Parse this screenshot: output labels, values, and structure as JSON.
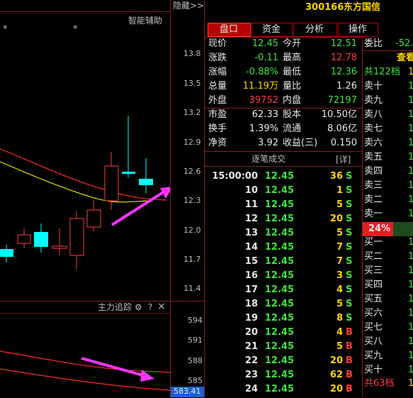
{
  "header": {
    "hide_label": "隐藏>>",
    "code": "300166",
    "name": "东方国信"
  },
  "chart": {
    "assist_label": "智能辅助",
    "stars": [
      "*",
      "*"
    ],
    "price_axis": [
      "13.8",
      "13.5",
      "13.2",
      "12.9",
      "12.6",
      "12.3",
      "12.0",
      "11.7",
      "11.4"
    ],
    "candle_colors": {
      "up": "#ff3b3b",
      "down": "#00ffff",
      "ma1": "#ff2a2a",
      "ma2": "#e8e000"
    },
    "arrow_color": "#ff33ff"
  },
  "tracker": {
    "title": "主力追踪",
    "gear_icon": "gear-icon",
    "help_icon": "?",
    "close_icon": "×",
    "axis": [
      "594",
      "591",
      "588",
      "585"
    ],
    "current_value": "583.41"
  },
  "tabs": [
    {
      "label": "盘口",
      "active": true
    },
    {
      "label": "资金",
      "active": false
    },
    {
      "label": "分析",
      "active": false
    },
    {
      "label": "操作",
      "active": false
    }
  ],
  "quote": {
    "rows": [
      {
        "l1": "现价",
        "v1": "12.45",
        "c1": "grn",
        "l2": "今开",
        "v2": "12.51",
        "c2": "grn"
      },
      {
        "l1": "涨跌",
        "v1": "-0.11",
        "c1": "grn",
        "l2": "最高",
        "v2": "12.78",
        "c2": "red"
      },
      {
        "l1": "涨幅",
        "v1": "-0.88%",
        "c1": "grn",
        "l2": "最低",
        "v2": "12.36",
        "c2": "grn"
      },
      {
        "l1": "总量",
        "v1": "11.19万",
        "c1": "yel",
        "l2": "量比",
        "v2": "1.26",
        "c2": "wht"
      },
      {
        "l1": "外盘",
        "v1": "39752",
        "c1": "red",
        "l2": "内盘",
        "v2": "72197",
        "c2": "grn"
      },
      {
        "l1": "市盈",
        "v1": "62.33",
        "c1": "wht",
        "l2": "股本",
        "v2": "10.50亿",
        "c2": "wht"
      },
      {
        "l1": "换手",
        "v1": "1.39%",
        "c1": "wht",
        "l2": "流通",
        "v2": "8.06亿",
        "c2": "wht"
      },
      {
        "l1": "净资",
        "v1": "3.92",
        "c1": "wht",
        "l2": "收益(三)",
        "v2": "0.150",
        "c2": "wht"
      }
    ]
  },
  "ticks": {
    "title": "逐笔成交",
    "detail_button": "[详]",
    "rows": [
      {
        "time": "15:00:00",
        "price": "12.45",
        "vol": "36",
        "side": "S"
      },
      {
        "time": "10",
        "price": "12.45",
        "vol": "1",
        "side": "S"
      },
      {
        "time": "11",
        "price": "12.45",
        "vol": "5",
        "side": "S"
      },
      {
        "time": "12",
        "price": "12.45",
        "vol": "20",
        "side": "S"
      },
      {
        "time": "13",
        "price": "12.45",
        "vol": "5",
        "side": "S"
      },
      {
        "time": "14",
        "price": "12.45",
        "vol": "7",
        "side": "S"
      },
      {
        "time": "15",
        "price": "12.45",
        "vol": "7",
        "side": "S"
      },
      {
        "time": "16",
        "price": "12.45",
        "vol": "3",
        "side": "S"
      },
      {
        "time": "17",
        "price": "12.45",
        "vol": "4",
        "side": "S"
      },
      {
        "time": "18",
        "price": "12.45",
        "vol": "5",
        "side": "S"
      },
      {
        "time": "19",
        "price": "12.45",
        "vol": "8",
        "side": "S"
      },
      {
        "time": "20",
        "price": "12.45",
        "vol": "4",
        "side": "B"
      },
      {
        "time": "21",
        "price": "12.45",
        "vol": "5",
        "side": "B"
      },
      {
        "time": "22",
        "price": "12.45",
        "vol": "20",
        "side": "B"
      },
      {
        "time": "23",
        "price": "12.45",
        "vol": "62",
        "side": "B"
      },
      {
        "time": "24",
        "price": "12.45",
        "vol": "20",
        "side": "B"
      }
    ]
  },
  "orderbook": {
    "ratio_label": "委比",
    "ratio_value": "-52.",
    "view_label": "查看",
    "sell_total": "共122档",
    "sell_total_digit": "1",
    "sells": [
      "卖十",
      "卖九",
      "卖八",
      "卖七",
      "卖六",
      "卖五",
      "卖四",
      "卖三",
      "卖二",
      "卖一"
    ],
    "buys": [
      "买一",
      "买二",
      "买三",
      "买四",
      "买五",
      "买六",
      "买七",
      "买八",
      "买九",
      "买十"
    ],
    "level_digit": "1",
    "percent": "24%",
    "buy_total": "共63档",
    "buy_total_digit": "1"
  }
}
